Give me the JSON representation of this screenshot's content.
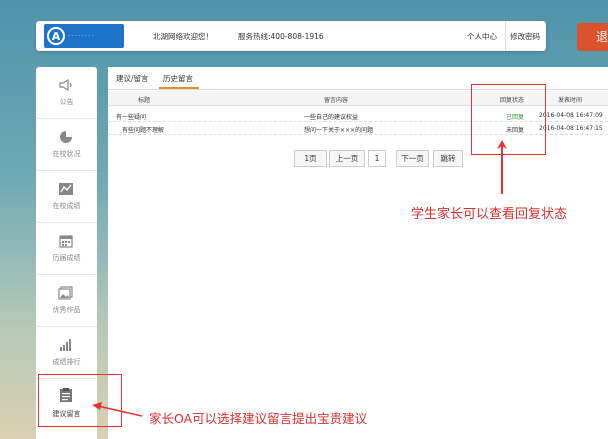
{
  "header": {
    "welcome": "北湖网络欢迎您！",
    "hotline": "服务热线:400-808-1916",
    "personal_center": "个人中心",
    "change_password": "修改密码",
    "logout": "退"
  },
  "sidebar": {
    "items": [
      {
        "label": "公告",
        "icon": "announcement-icon"
      },
      {
        "label": "在校状况",
        "icon": "pie-chart-icon"
      },
      {
        "label": "在校成绩",
        "icon": "trend-chart-icon"
      },
      {
        "label": "历届成绩",
        "icon": "calendar-icon"
      },
      {
        "label": "优秀作品",
        "icon": "gallery-icon"
      },
      {
        "label": "成绩排行",
        "icon": "bar-chart-icon"
      },
      {
        "label": "建议留言",
        "icon": "clipboard-icon"
      }
    ]
  },
  "tabs": [
    "建议/留言",
    "历史留言"
  ],
  "table": {
    "headers": [
      "标题",
      "留言内容",
      "回复状态",
      "发表时间"
    ],
    "rows": [
      {
        "title": "有一些疑问",
        "content": "一些自己的建议权益",
        "status": "已回复",
        "time": "2016-04-08 16:47:09"
      },
      {
        "title": "有些问题不理解",
        "content": "想问一下关于×××的问题",
        "status": "未回复",
        "time": "2016-04-08 16:47:15"
      }
    ]
  },
  "pager": {
    "first": "1页",
    "prev": "上一页",
    "current": "1",
    "next": "下一页",
    "jump": "跳转"
  },
  "annotations": {
    "status_note": "学生家长可以查看回复状态",
    "oa_note": "家长OA可以选择建议留言提出宝贵建议"
  },
  "colors": {
    "highlight": "#e53333",
    "accent": "#e08a3c",
    "replied": "#2e9a2e"
  }
}
